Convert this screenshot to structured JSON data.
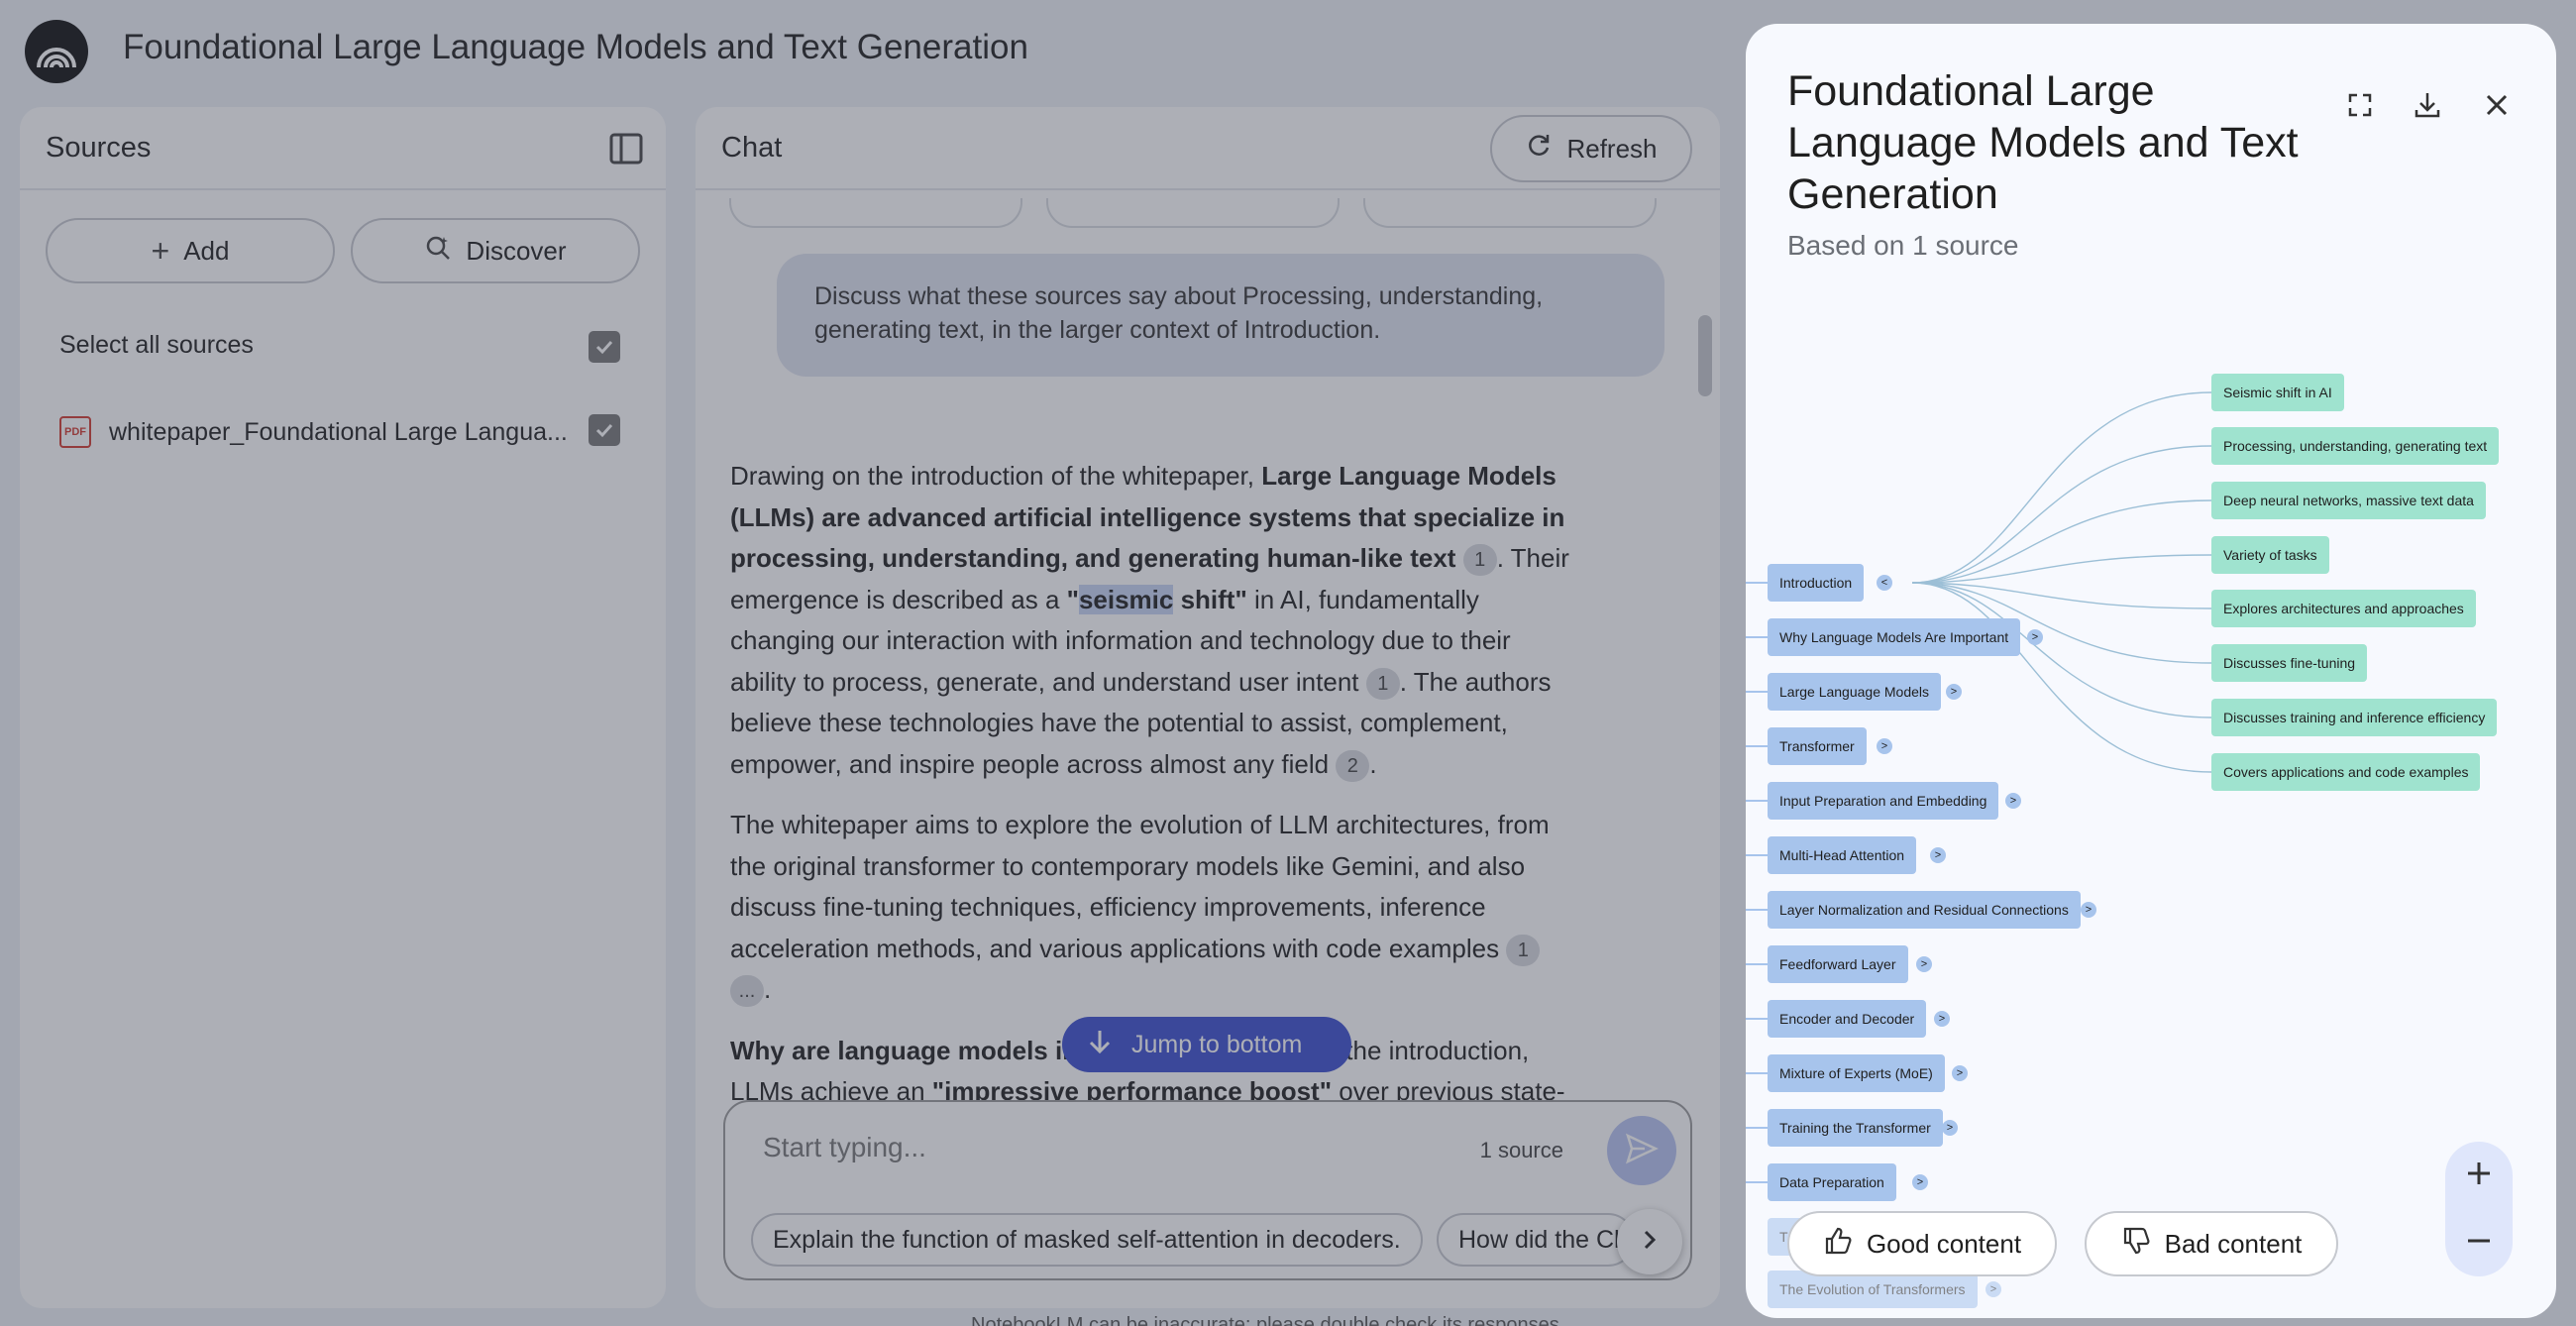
{
  "app": {
    "title": "Foundational Large Language Models and Text Generation"
  },
  "sources_panel": {
    "title": "Sources",
    "add_label": "Add",
    "discover_label": "Discover",
    "select_all_label": "Select all sources",
    "items": [
      {
        "icon": "pdf-icon",
        "name": "whitepaper_Foundational Large Langua...",
        "checked": true
      }
    ]
  },
  "chat": {
    "title": "Chat",
    "refresh_label": "Refresh",
    "user_message": "Discuss what these sources say about Processing, understanding, generating text, in the larger context of Introduction.",
    "answer": {
      "p1_a": "Drawing on the introduction of the whitepaper, ",
      "p1_bold": "Large Language Models (LLMs) are advanced artificial intelligence systems that specialize in processing, understanding, and generating human-like text",
      "p1_b": ". Their emergence is described as a ",
      "p1_bold2_pre": "\"",
      "p1_bold2_hl": "seismic",
      "p1_bold2_post": " shift\"",
      "p1_c": " in AI, fundamentally changing our interaction with information and technology due to their ability to process, generate, and understand user intent ",
      "p1_d": ". The authors believe these technologies have the potential to assist, complement, empower, and inspire people across almost any field ",
      "p1_e": ".",
      "p2": "The whitepaper aims to explore the evolution of LLM architectures, from the original transformer to contemporary models like Gemini, and also discuss fine-tuning techniques, efficiency improvements, inference acceleration methods, and various applications with code examples ",
      "p2_end": ".",
      "p3_bold": "Why are language models important?",
      "p3_a": " According to the introduction, LLMs achieve an ",
      "p3_bold2": "\"impressive performance boost\"",
      "p3_b": " over previous state-of-the-art Natural Language Processing (NLP) models across diverse and complex",
      "cite_1": "1",
      "cite_2": "2",
      "cite_more": "..."
    },
    "jump_label": "Jump to bottom",
    "composer_placeholder": "Start typing...",
    "source_count": "1 source",
    "suggestions": [
      "Explain the function of masked self-attention in decoders.",
      "How did the Chinchilla paper change scaling laws?"
    ],
    "footer": "NotebookLM can be inaccurate; please double check its responses."
  },
  "mindmap": {
    "title": "Foundational Large Language Models and Text Generation",
    "subtitle": "Based on 1 source",
    "root_children": [
      "Seismic shift in AI",
      "Processing, understanding, generating text",
      "Deep neural networks, massive text data",
      "Variety of tasks",
      "Explores architectures and approaches",
      "Discusses fine-tuning",
      "Discusses training and inference efficiency",
      "Covers applications and code examples"
    ],
    "topics": [
      "Introduction",
      "Why Language Models Are Important",
      "Large Language Models",
      "Transformer",
      "Input Preparation and Embedding",
      "Multi-Head Attention",
      "Layer Normalization and Residual Connections",
      "Feedforward Layer",
      "Encoder and Decoder",
      "Mixture of Experts (MoE)",
      "Training the Transformer",
      "Data Preparation",
      "T",
      "The Evolution of Transformers"
    ],
    "expand_glyph": ">",
    "collapse_glyph": "<",
    "good_label": "Good content",
    "bad_label": "Bad content",
    "colors": {
      "topic": "#a7c4ec",
      "leaf": "#9fe3cf",
      "accent": "#3b4fcf"
    }
  }
}
